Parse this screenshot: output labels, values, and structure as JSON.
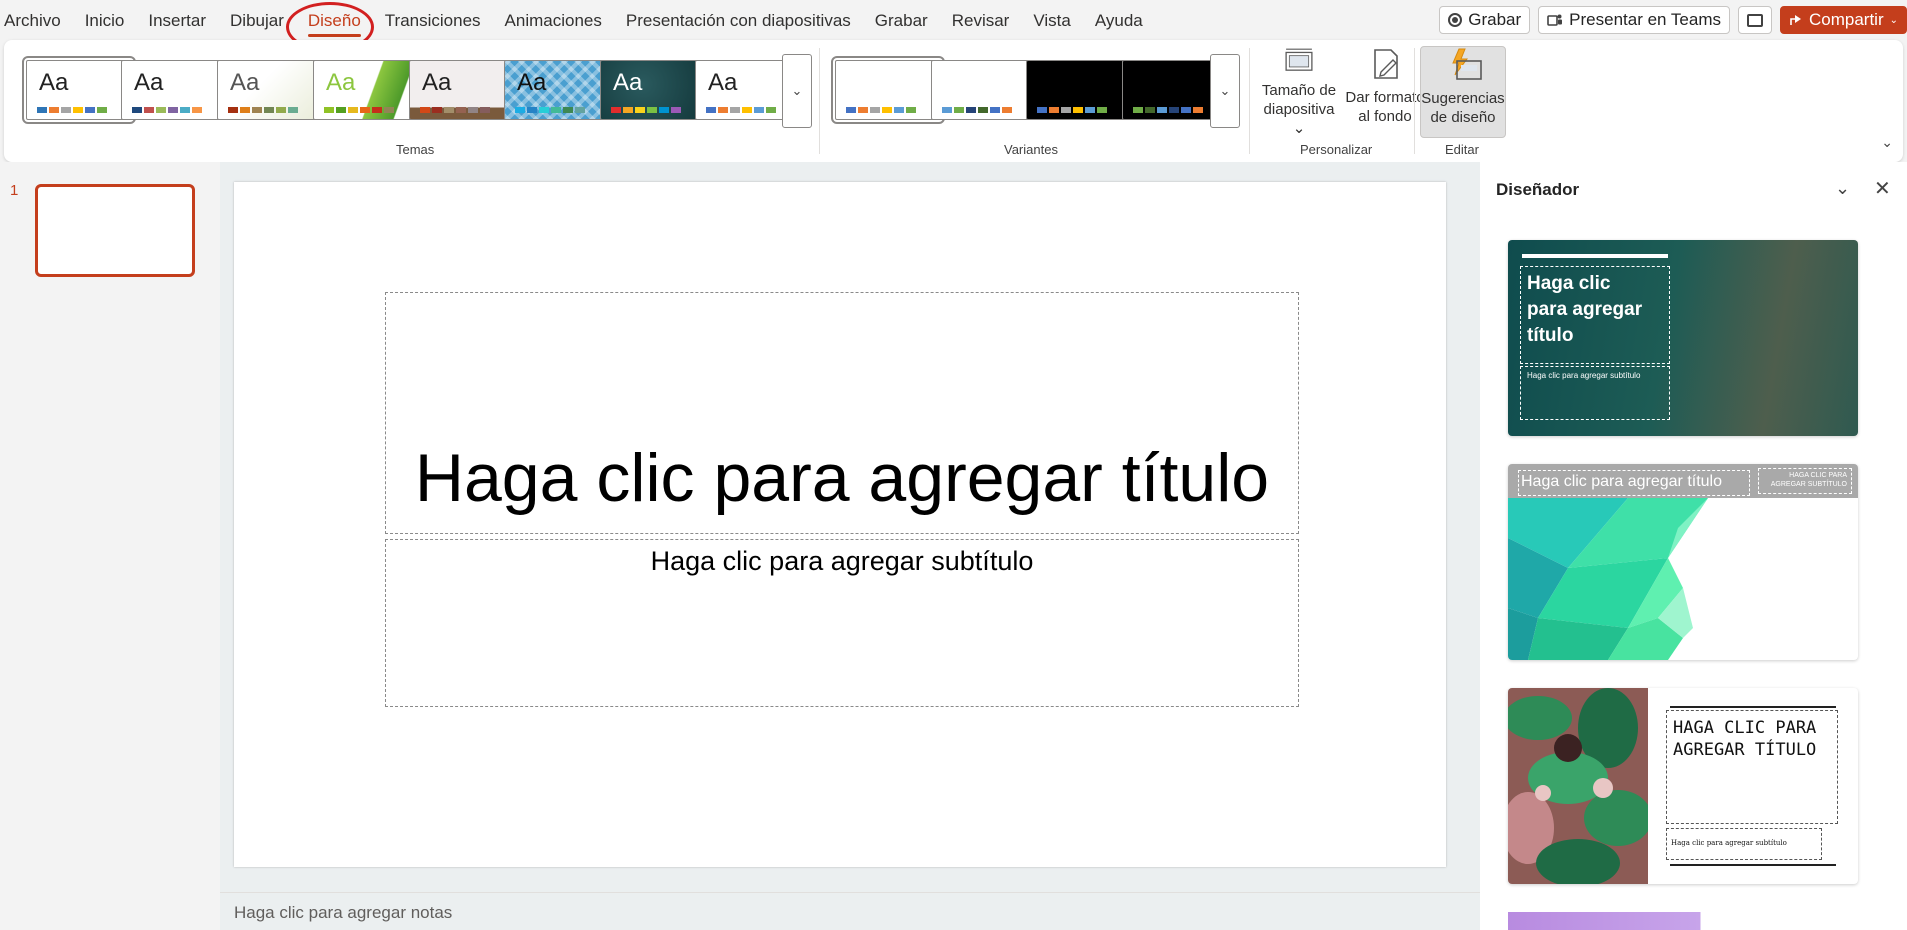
{
  "menu": {
    "tabs": [
      "Archivo",
      "Inicio",
      "Insertar",
      "Dibujar",
      "Diseño",
      "Transiciones",
      "Animaciones",
      "Presentación con diapositivas",
      "Grabar",
      "Revisar",
      "Vista",
      "Ayuda"
    ],
    "active_tab": "Diseño"
  },
  "topright": {
    "record_label": "Grabar",
    "teams_label": "Presentar en Teams",
    "share_label": "Compartir"
  },
  "ribbon": {
    "themes_label": "Temas",
    "variants_label": "Variantes",
    "customize_label": "Personalizar",
    "edit_label": "Editar",
    "theme_sample_text": "Aa",
    "slide_size_label_1": "Tamaño de",
    "slide_size_label_2": "diapositiva",
    "bg_format_label_1": "Dar formato",
    "bg_format_label_2": "al fondo",
    "design_ideas_label_1": "Sugerencias",
    "design_ideas_label_2": "de diseño",
    "accent_color": "#c43e1c"
  },
  "slides_panel": {
    "slide_number": "1"
  },
  "slide": {
    "title_placeholder": "Haga clic para agregar título",
    "subtitle_placeholder": "Haga clic para agregar subtítulo"
  },
  "notes": {
    "placeholder": "Haga clic para agregar notas"
  },
  "designer": {
    "title": "Diseñador",
    "card1": {
      "title_lines": [
        "Haga clic",
        "para agregar",
        "título"
      ],
      "subtitle": "Haga clic para agregar subtítulo"
    },
    "card2": {
      "title": "Haga clic para agregar título",
      "subtitle_lines": [
        "HAGA CLIC PARA",
        "AGREGAR SUBTÍTULO"
      ]
    },
    "card3": {
      "title_lines": [
        "HAGA CLIC PARA",
        "AGREGAR TÍTULO"
      ],
      "subtitle": "Haga clic para agregar subtítulo"
    }
  }
}
